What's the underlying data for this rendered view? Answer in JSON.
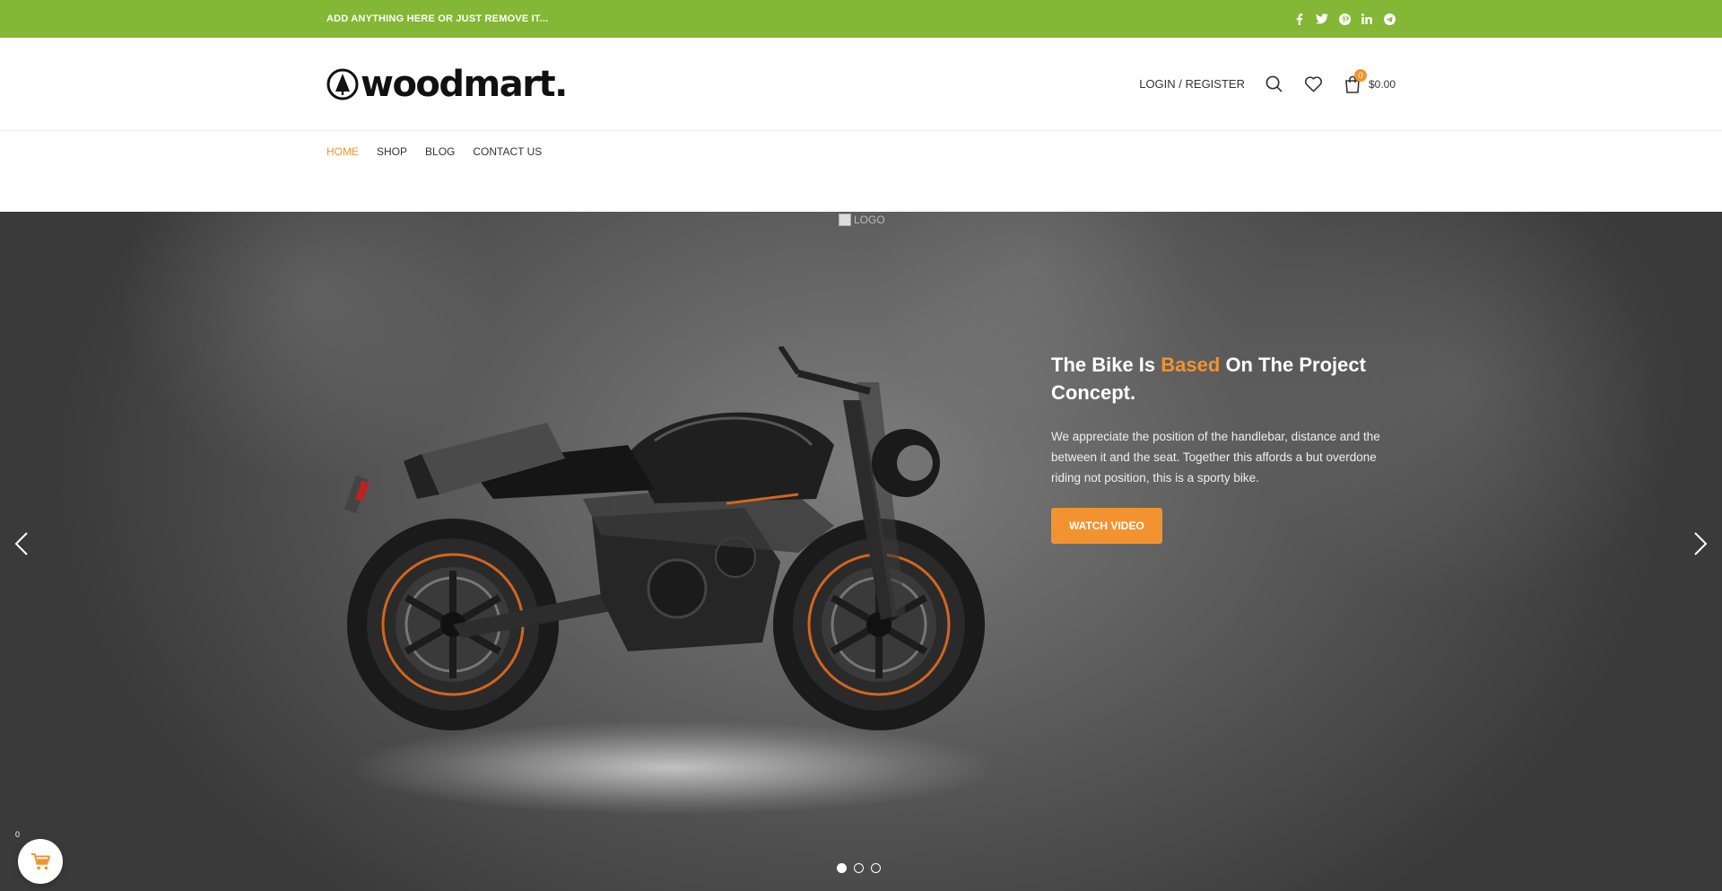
{
  "topbar": {
    "text": "ADD ANYTHING HERE OR JUST REMOVE IT...",
    "socials": [
      "facebook-icon",
      "twitter-icon",
      "pinterest-icon",
      "linkedin-icon",
      "telegram-icon"
    ]
  },
  "header": {
    "logo_text": "woodmart.",
    "login_label": "LOGIN / REGISTER",
    "cart_count": "0",
    "cart_total": "$0.00"
  },
  "nav": {
    "items": [
      {
        "label": "HOME",
        "active": true
      },
      {
        "label": "SHOP",
        "active": false
      },
      {
        "label": "BLOG",
        "active": false
      },
      {
        "label": "CONTACT US",
        "active": false
      }
    ]
  },
  "hero": {
    "broken_image_alt": "LOGO",
    "title_part1": "The Bike Is ",
    "title_accent": "Based",
    "title_part2": " On The Project Concept.",
    "description": "We appreciate the position of the handlebar, distance and the between it and the seat. Together this affords a but overdone riding not position, this is a sporty bike.",
    "button_label": "WATCH VIDEO",
    "slide_count": 3,
    "active_slide": 1
  },
  "floating_cart": {
    "count": "0"
  },
  "colors": {
    "topbar": "#83b735",
    "accent": "#f2932f"
  }
}
